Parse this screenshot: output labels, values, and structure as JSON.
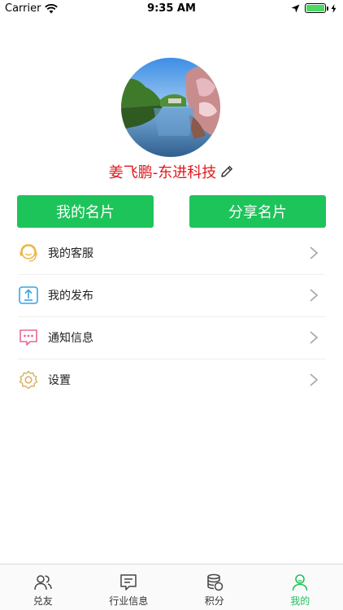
{
  "status_bar": {
    "carrier": "Carrier",
    "time": "9:35 AM",
    "battery_level": 1.0
  },
  "profile": {
    "name": "姜飞鹏-东进科技"
  },
  "actions": {
    "my_card": "我的名片",
    "share_card": "分享名片"
  },
  "menu": {
    "items": [
      {
        "label": "我的客服",
        "icon": "customer-service-icon"
      },
      {
        "label": "我的发布",
        "icon": "upload-icon"
      },
      {
        "label": "通知信息",
        "icon": "message-icon"
      },
      {
        "label": "设置",
        "icon": "gear-icon"
      }
    ]
  },
  "tabs": [
    {
      "label": "兑友",
      "icon": "friends-icon",
      "active": false
    },
    {
      "label": "行业信息",
      "icon": "news-icon",
      "active": false
    },
    {
      "label": "积分",
      "icon": "coins-icon",
      "active": false
    },
    {
      "label": "我的",
      "icon": "person-icon",
      "active": true
    }
  ],
  "colors": {
    "accent": "#1dc45a",
    "name": "#e0181b"
  }
}
